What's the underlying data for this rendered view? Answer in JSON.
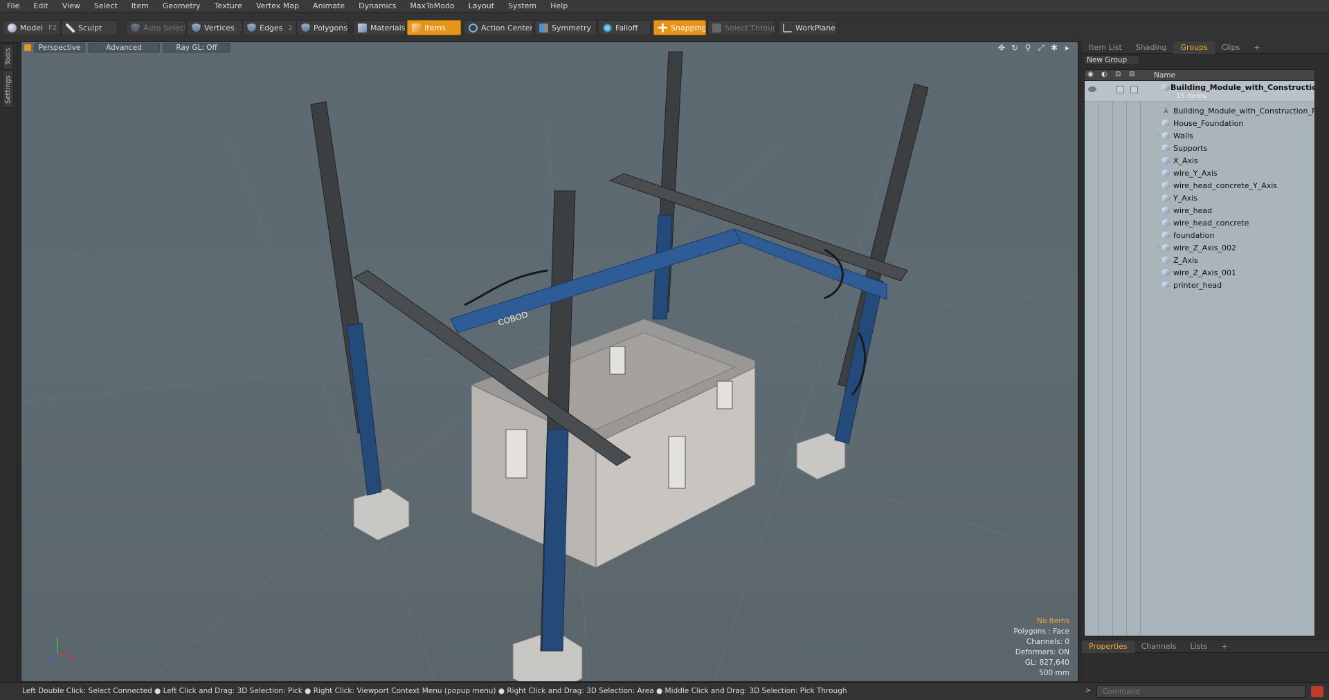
{
  "menu": [
    "File",
    "Edit",
    "View",
    "Select",
    "Item",
    "Geometry",
    "Texture",
    "Vertex Map",
    "Animate",
    "Dynamics",
    "MaxToModo",
    "Layout",
    "System",
    "Help"
  ],
  "toolbar": {
    "model": {
      "label": "Model",
      "key": "F2"
    },
    "sculpt": {
      "label": "Sculpt"
    },
    "auto_select": {
      "label": "Auto Select"
    },
    "vertices": {
      "label": "Vertices",
      "key": "1"
    },
    "edges": {
      "label": "Edges",
      "key": "2"
    },
    "polygons": {
      "label": "Polygons"
    },
    "materials": {
      "label": "Materials"
    },
    "items": {
      "label": "Items"
    },
    "action_center": {
      "label": "Action Center"
    },
    "symmetry": {
      "label": "Symmetry"
    },
    "falloff": {
      "label": "Falloff"
    },
    "snapping": {
      "label": "Snapping"
    },
    "select_through": {
      "label": "Select Through"
    },
    "workplane": {
      "label": "WorkPlane"
    }
  },
  "left_tabs": [
    "Tools",
    "Settings"
  ],
  "viewport": {
    "view": "Perspective",
    "mode": "Advanced",
    "raygl": "Ray GL: Off",
    "info": {
      "selection": "No Items",
      "polygons": "Polygons : Face",
      "channels": "Channels: 0",
      "deformers": "Deformers: ON",
      "gl": "GL: 827,640",
      "scale": "500 mm"
    },
    "brand_text": "COBOD"
  },
  "right_panel": {
    "tabs": [
      "Item List",
      "Shading",
      "Groups",
      "Clips",
      "+"
    ],
    "active_tab": "Groups",
    "new_group": "New Group",
    "column_name": "Name",
    "group": {
      "name": "Building_Module_with_Constructio...",
      "count": "15 Items"
    },
    "items": [
      {
        "name": "Building_Module_with_Construction_P ...",
        "type": "locator"
      },
      {
        "name": "House_Foundation",
        "type": "mesh"
      },
      {
        "name": "Walls",
        "type": "mesh"
      },
      {
        "name": "Supports",
        "type": "mesh"
      },
      {
        "name": "X_Axis",
        "type": "mesh"
      },
      {
        "name": "wire_Y_Axis",
        "type": "mesh"
      },
      {
        "name": "wire_head_concrete_Y_Axis",
        "type": "mesh"
      },
      {
        "name": "Y_Axis",
        "type": "mesh"
      },
      {
        "name": "wire_head",
        "type": "mesh"
      },
      {
        "name": "wire_head_concrete",
        "type": "mesh"
      },
      {
        "name": "foundation",
        "type": "mesh"
      },
      {
        "name": "wire_Z_Axis_002",
        "type": "mesh"
      },
      {
        "name": "Z_Axis",
        "type": "mesh"
      },
      {
        "name": "wire_Z_Axis_001",
        "type": "mesh"
      },
      {
        "name": "printer_head",
        "type": "mesh"
      }
    ]
  },
  "bottom_panel": {
    "tabs": [
      "Properties",
      "Channels",
      "Lists",
      "+"
    ],
    "active_tab": "Properties"
  },
  "status": {
    "hint": "Left Double Click: Select Connected ● Left Click and Drag: 3D Selection: Pick ● Right Click: Viewport Context Menu (popup menu) ● Right Click and Drag: 3D Selection: Area ● Middle Click and Drag: 3D Selection: Pick Through",
    "command_placeholder": "Command"
  },
  "colors": {
    "accent": "#e8941a",
    "active_tab_text": "#f0a830",
    "viewport_bg": "#5f6b72"
  }
}
